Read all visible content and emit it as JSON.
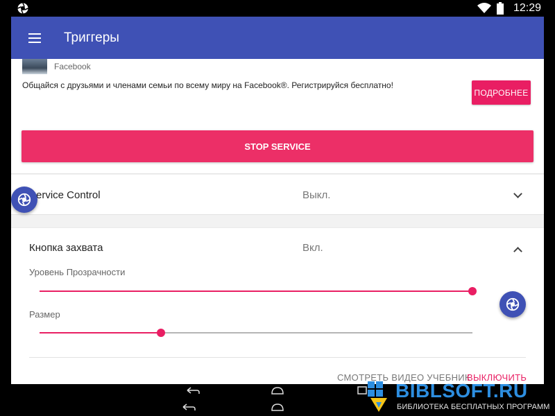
{
  "status_bar": {
    "time": "12:29",
    "left_icon": "shutter-icon",
    "right_icons": [
      "wifi-icon",
      "battery-icon"
    ]
  },
  "toolbar": {
    "title": "Триггеры",
    "menu_icon": "menu-icon"
  },
  "ad": {
    "source": "Facebook",
    "description": "Общайся с друзьями и членами семьи по всему миру на Facebook®. Регистрируйся бесплатно!",
    "button_label": "ПОДРОБНЕЕ"
  },
  "stop_service": {
    "label": "STOP SERVICE"
  },
  "service_control": {
    "label": "Service Control",
    "value": "Выкл."
  },
  "capture": {
    "label": "Кнопка захвата",
    "value": "Вкл.",
    "opacity_label": "Уровень Прозрачности",
    "opacity_level": 1.0,
    "size_label": "Размер",
    "size_level": 0.28,
    "tutorial_label": "СМОТРЕТЬ ВИДЕО УЧЕБНИК",
    "disable_label": "ВЫКЛЮЧИТЬ"
  },
  "navigation": {
    "icons": [
      "back-icon",
      "home-icon",
      "recents-icon"
    ]
  },
  "watermark": {
    "title": "BIBLSOFT.RU",
    "subtitle": "БИБЛИОТЕКА БЕСПЛАТНЫХ ПРОГРАММ"
  },
  "colors": {
    "primary": "#3f51b5",
    "accent": "#e91e63",
    "watermark": "#2d8ee0"
  }
}
